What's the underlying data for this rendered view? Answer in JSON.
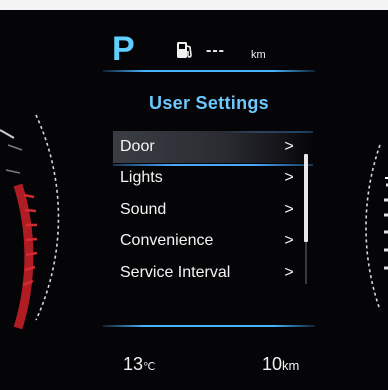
{
  "gear": "P",
  "fuel": {
    "icon": "fuel-pump-icon",
    "range_value": "---",
    "range_unit": "km"
  },
  "menu": {
    "title": "User Settings",
    "items": [
      {
        "label": "Door",
        "chevron": ">",
        "selected": true
      },
      {
        "label": "Lights",
        "chevron": ">"
      },
      {
        "label": "Sound",
        "chevron": ">"
      },
      {
        "label": "Convenience",
        "chevron": ">"
      },
      {
        "label": "Service Interval",
        "chevron": ">"
      }
    ],
    "scroll_position": 0.0
  },
  "footer": {
    "temperature": {
      "value": "13",
      "unit": "℃"
    },
    "distance": {
      "value": "10",
      "unit": "km"
    }
  },
  "colors": {
    "accent": "#5fd0ff",
    "accent_line": "#4ab4ff",
    "gauge_red": "#c0222a",
    "text": "#f5f5f5",
    "background": "#050507"
  }
}
